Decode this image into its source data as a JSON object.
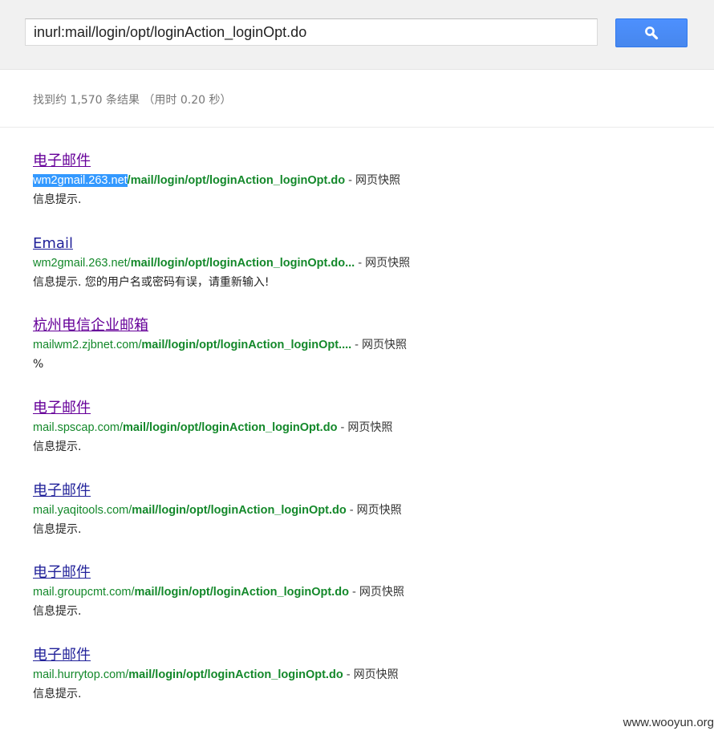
{
  "search": {
    "query": "inurl:mail/login/opt/loginAction_loginOpt.do",
    "button_icon": "search-icon",
    "button_color": "#4d90fe"
  },
  "stats": {
    "text": "找到约 1,570 条结果 （用时 0.20 秒）"
  },
  "results": [
    {
      "title": "电子邮件",
      "host": "wm2gmail.263.net",
      "path": "/mail/login/opt/loginAction_loginOpt.do",
      "sep": " - ",
      "cache": "网页快照",
      "snippet": "信息提示."
    },
    {
      "title": "Email",
      "host": "wm2gmail.263.net/",
      "path": "mail/login/opt/loginAction_loginOpt.do...",
      "sep": " - ",
      "cache": "网页快照",
      "snippet": "信息提示. 您的用户名或密码有误，请重新输入!"
    },
    {
      "title": "杭州电信企业邮箱",
      "host": "mailwm2.zjbnet.com/",
      "path": "mail/login/opt/loginAction_loginOpt....",
      "sep": " - ",
      "cache": "网页快照",
      "snippet": "%"
    },
    {
      "title": "电子邮件",
      "host": "mail.spscap.com/",
      "path": "mail/login/opt/loginAction_loginOpt.do",
      "sep": " - ",
      "cache": "网页快照",
      "snippet": "信息提示."
    },
    {
      "title": "电子邮件",
      "host": "mail.yaqitools.com/",
      "path": "mail/login/opt/loginAction_loginOpt.do",
      "sep": " - ",
      "cache": "网页快照",
      "snippet": "信息提示."
    },
    {
      "title": "电子邮件",
      "host": "mail.groupcmt.com/",
      "path": "mail/login/opt/loginAction_loginOpt.do",
      "sep": " - ",
      "cache": "网页快照",
      "snippet": "信息提示."
    },
    {
      "title": "电子邮件",
      "host": "mail.hurrytop.com/",
      "path": "mail/login/opt/loginAction_loginOpt.do",
      "sep": " - ",
      "cache": "网页快照",
      "snippet": "信息提示."
    }
  ],
  "watermark": {
    "text": "www.wooyun.org"
  },
  "colors": {
    "url_green": "#13882a",
    "visited_title": "#660099",
    "unvisited_title": "#22229a",
    "selection": "#3399ff"
  }
}
